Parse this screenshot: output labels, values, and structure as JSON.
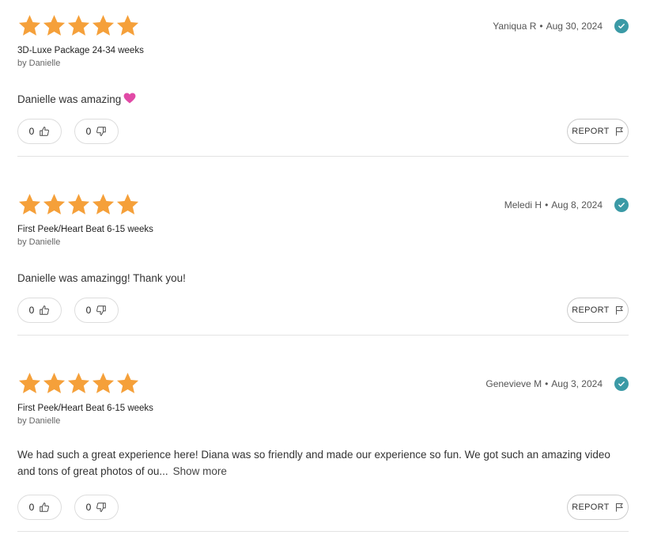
{
  "colors": {
    "star": "#f5a03a",
    "verified": "#3b9aa6",
    "divider": "#e3e3e3"
  },
  "icons": {
    "star": "star-icon",
    "verified": "checkmark-circle-icon",
    "thumbs_up": "thumbs-up-icon",
    "thumbs_down": "thumbs-down-icon",
    "flag": "flag-icon",
    "heart": "pink-heart-emoji"
  },
  "reviews": [
    {
      "rating": 5,
      "author": "Yaniqua R",
      "separator": "•",
      "date": "Aug 30, 2024",
      "service": "3D-Luxe Package 24-34 weeks",
      "by_label": "by",
      "provider": "Danielle",
      "text": "Danielle was amazing",
      "helpful_count": "0",
      "unhelpful_count": "0",
      "report_label": "REPORT"
    },
    {
      "rating": 5,
      "author": "Meledi H",
      "separator": "•",
      "date": "Aug 8, 2024",
      "service": "First Peek/Heart Beat 6-15 weeks",
      "by_label": "by",
      "provider": "Danielle",
      "text": "Danielle was amazingg! Thank you!",
      "helpful_count": "0",
      "unhelpful_count": "0",
      "report_label": "REPORT"
    },
    {
      "rating": 5,
      "author": "Genevieve M",
      "separator": "•",
      "date": "Aug 3, 2024",
      "service": "First Peek/Heart Beat 6-15 weeks",
      "by_label": "by",
      "provider": "Danielle",
      "text": "We had such a great experience here! Diana was so friendly and made our experience so fun. We got such an amazing video and tons of great photos of ou...",
      "show_more_label": "Show more",
      "helpful_count": "0",
      "unhelpful_count": "0",
      "report_label": "REPORT"
    }
  ]
}
